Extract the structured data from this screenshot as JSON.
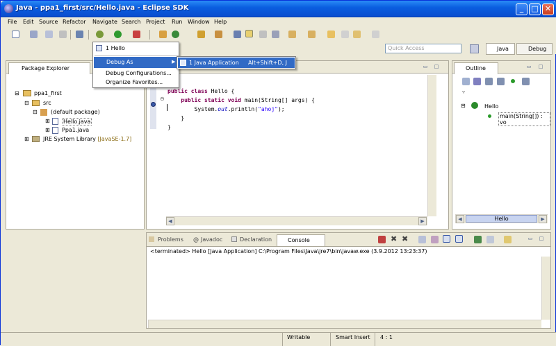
{
  "window": {
    "title": "Java - ppa1_first/src/Hello.java - Eclipse SDK",
    "btn_min": "_",
    "btn_max": "□",
    "btn_close": "✕"
  },
  "menu": [
    "File",
    "Edit",
    "Source",
    "Refactor",
    "Navigate",
    "Search",
    "Project",
    "Run",
    "Window",
    "Help"
  ],
  "quick_access": {
    "placeholder": "Quick Access"
  },
  "perspectives": {
    "java": "Java",
    "debug": "Debug"
  },
  "package_explorer": {
    "title": "Package Explorer",
    "project": "ppa1_first",
    "src": "src",
    "package": "(default package)",
    "files": [
      "Hello.java",
      "Ppa1.java"
    ],
    "jre": "JRE System Library",
    "jre_version": "[JavaSE-1.7]"
  },
  "editor": {
    "lines": [
      "public class Hello {",
      "    public static void main(String[] args) {",
      "        System.out.println(\"ahoj\");",
      "    }",
      "}"
    ]
  },
  "debug_menu": {
    "items": [
      "1 Hello",
      "Debug As",
      "Debug Configurations...",
      "Organize Favorites..."
    ],
    "submenu_item": "1 Java Application",
    "submenu_shortcut": "Alt+Shift+D, J"
  },
  "outline": {
    "title": "Outline",
    "class": "Hello",
    "method": "main(String[]) : vo",
    "hscroll": "Hello"
  },
  "bottom_tabs": {
    "problems": "Problems",
    "javadoc": "Javadoc",
    "declaration": "Declaration",
    "console": "Console"
  },
  "console": {
    "line": "<terminated> Hello [Java Application] C:\\Program Files\\Java\\jre7\\bin\\javaw.exe (3.9.2012 13:23:37)"
  },
  "status": {
    "writable": "Writable",
    "insert": "Smart Insert",
    "position": "4 : 1"
  },
  "colors": {
    "keyword": "#7f0055",
    "string": "#2a00ff",
    "selection": "#316ac5",
    "title": "#0a5ee0"
  }
}
